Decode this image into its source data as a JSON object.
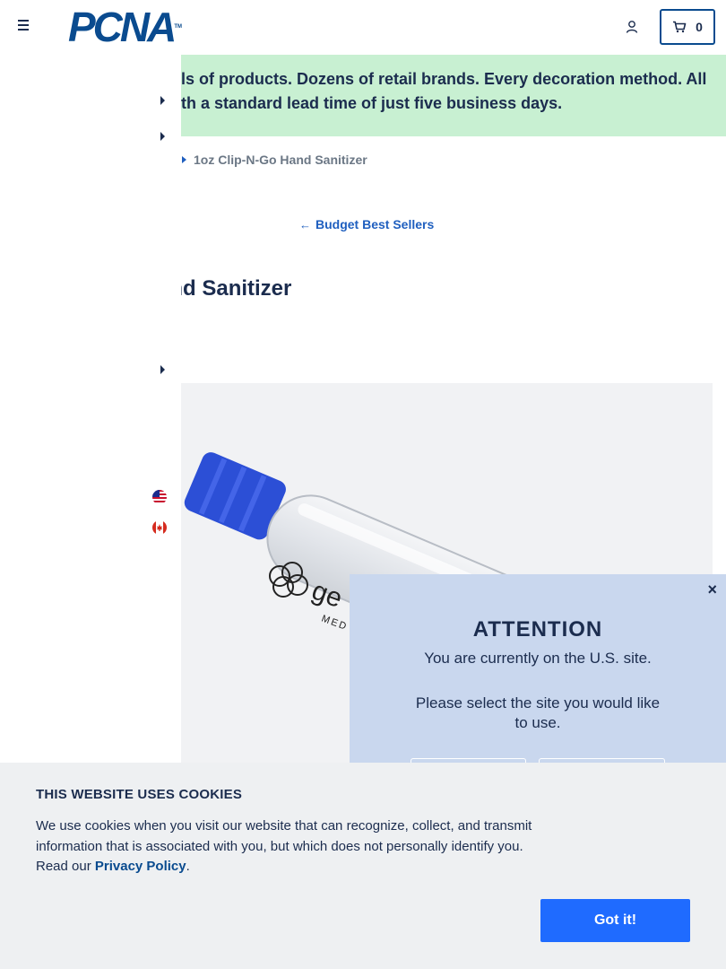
{
  "header": {
    "logo_text": "PCNA",
    "logo_tm": "TM",
    "cart_count": "0",
    "brand_color": "#0a4b8f"
  },
  "banner": {
    "line1": "ls of products. Dozens of retail brands. Every decoration method. All",
    "line2": "th a standard lead time of just five business days.",
    "bg_color": "#c8f0d2"
  },
  "breadcrumb": {
    "current": "1oz Clip-N-Go Hand Sanitizer"
  },
  "back_link": {
    "arrow": "←",
    "label": "Budget Best Sellers"
  },
  "product": {
    "title_visible": "and Sanitizer",
    "imprint_text": "ge",
    "imprint_sub": "MED"
  },
  "sidebar": {
    "icons": [
      "caret-right-icon",
      "caret-right-icon",
      "caret-right-icon",
      "us-flag-icon",
      "canada-flag-icon"
    ]
  },
  "attention_modal": {
    "close": "×",
    "title": "ATTENTION",
    "line1": "You are currently on the U.S. site.",
    "line2": "Please select the site you would like to use.",
    "bg_color": "#c9d7ee"
  },
  "cookie_banner": {
    "title": "THIS WEBSITE USES COOKIES",
    "text_before": "We use cookies when you visit our website that can recognize, collect, and transmit information that is associated with you, but which does not personally identify you. Read our ",
    "policy_link": "Privacy Policy",
    "text_after": ".",
    "button_label": "Got it!",
    "button_color": "#1f6bff"
  }
}
